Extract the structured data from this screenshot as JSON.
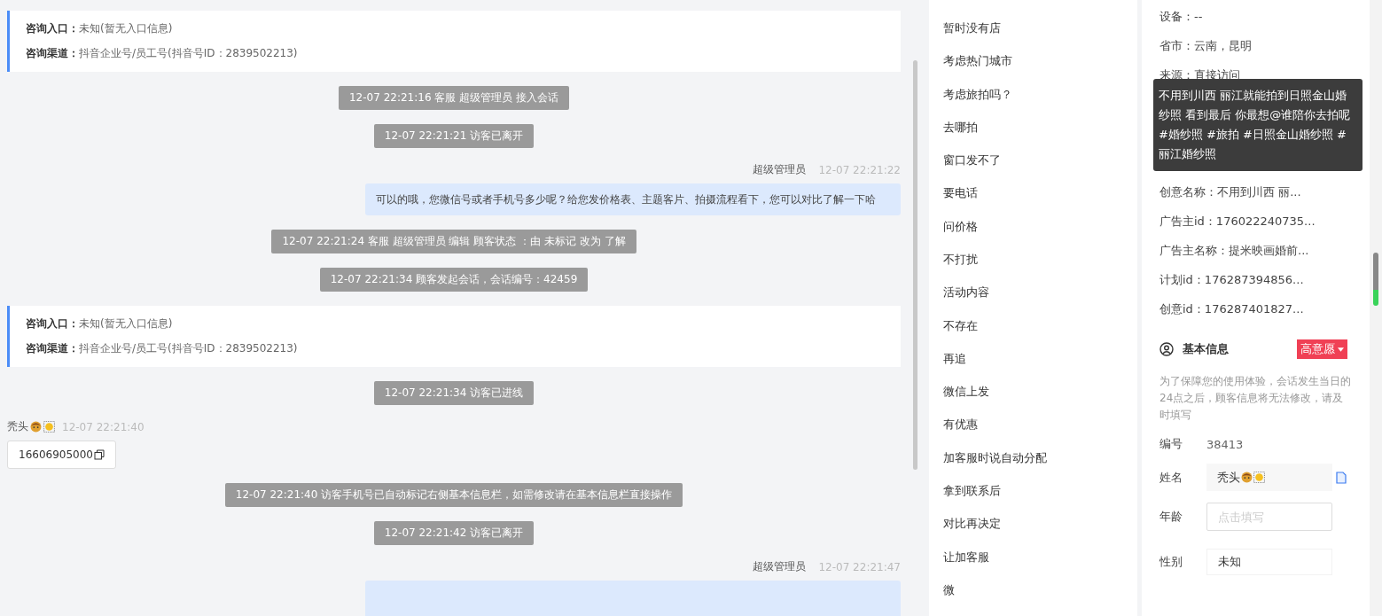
{
  "chat": [
    {
      "kind": "info_card",
      "rows": [
        {
          "label": "咨询入口：",
          "value": "未知(暂无入口信息)"
        },
        {
          "label": "咨询渠道：",
          "value": "抖音企业号/员工号(抖音号ID：2839502213)"
        }
      ]
    },
    {
      "kind": "system",
      "text": "12-07 22:21:16 客服 超级管理员 接入会话"
    },
    {
      "kind": "system",
      "text": "12-07 22:21:21 访客已离开"
    },
    {
      "kind": "agent",
      "name": "超级管理员",
      "time": "12-07 22:21:22",
      "text": "可以的哦，您微信号或者手机号多少呢？给您发价格表、主题客片、拍摄流程看下，您可以对比了解一下哈"
    },
    {
      "kind": "system",
      "text": "12-07 22:21:24 客服 超级管理员 编辑 顾客状态 ：由 未标记 改为 了解"
    },
    {
      "kind": "system",
      "text": "12-07 22:21:34 顾客发起会话，会话编号：42459"
    },
    {
      "kind": "info_card",
      "rows": [
        {
          "label": "咨询入口：",
          "value": "未知(暂无入口信息)"
        },
        {
          "label": "咨询渠道：",
          "value": "抖音企业号/员工号(抖音号ID：2839502213)"
        }
      ]
    },
    {
      "kind": "system",
      "text": "12-07 22:21:34 访客已进线"
    },
    {
      "kind": "visitor",
      "name": "秃头",
      "time": "12-07 22:21:40",
      "text": "16606905000"
    },
    {
      "kind": "system",
      "text": "12-07 22:21:40 访客手机号已自动标记右侧基本信息栏，如需修改请在基本信息栏直接操作"
    },
    {
      "kind": "system",
      "text": "12-07 22:21:42 访客已离开"
    },
    {
      "kind": "agent_cut",
      "name": "超级管理员",
      "time": "12-07 22:21:47"
    }
  ],
  "quick_replies": [
    "暂时没有店",
    "考虑热门城市",
    "考虑旅拍吗？",
    "去哪拍",
    "窗口发不了",
    "要电话",
    "问价格",
    "不打扰",
    "活动内容",
    "不存在",
    "再追",
    "微信上发",
    "有优惠",
    "加客服时说自动分配",
    "拿到联系后",
    "对比再决定",
    "让加客服",
    "微"
  ],
  "visit_info": {
    "rows_top": [
      "设备：--",
      "省市：云南，昆明",
      "来源：直接访问"
    ],
    "tooltip": "不用到川西 丽江就能拍到日照金山婚纱照 看到最后 你最想@谁陪你去拍呢 #婚纱照 #旅拍 #日照金山婚纱照 #丽江婚纱照",
    "rows_bottom": [
      "创意名称：不用到川西 丽...",
      "广告主id：176022240735...",
      "广告主名称：提米映画婚前...",
      "计划id：176287394856...",
      "创意id：176287401827..."
    ]
  },
  "basic_info": {
    "title": "基本信息",
    "intent_tag": "高意愿",
    "notice": "为了保障您的使用体验，会话发生当日的24点之后，顾客信息将无法修改，请及时填写",
    "fields": [
      {
        "kind": "static",
        "label": "编号",
        "value": "38413"
      },
      {
        "kind": "name",
        "label": "姓名",
        "value": "秃头"
      },
      {
        "kind": "input",
        "label": "年龄",
        "placeholder": "点击填写"
      },
      {
        "kind": "select",
        "label": "性别",
        "value": "未知"
      }
    ]
  }
}
